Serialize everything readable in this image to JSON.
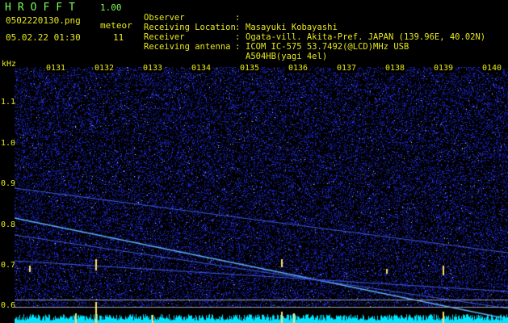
{
  "header": {
    "app_name": "HROFFT",
    "version": "1.00",
    "filename": "0502220130.png",
    "datetime": "05.02.22 01:30",
    "meteor_label": "meteor",
    "meteor_count": "11"
  },
  "info": [
    {
      "key": "Observer",
      "value": "Masayuki Kobayashi"
    },
    {
      "key": "Receiving Location",
      "value": "Ogata-vill. Akita-Pref. JAPAN (139.96E, 40.02N)"
    },
    {
      "key": "Receiver",
      "value": "ICOM IC-575 53.7492(@LCD)MHz USB"
    },
    {
      "key": "Receiving antenna",
      "value": "A504HB(yagi 4el)"
    }
  ],
  "axis": {
    "unit": "kHz",
    "freq_ticks": [
      "1.1",
      "1.0",
      "0.9",
      "0.8",
      "0.7",
      "0.6"
    ],
    "time_ticks": [
      "0131",
      "0132",
      "0133",
      "0134",
      "0135",
      "0136",
      "0137",
      "0138",
      "0139",
      "0140"
    ]
  },
  "colors": {
    "label": "#e8e81e",
    "title": "#7CFC55",
    "noise": "#1a22c8",
    "signal": "#5fb0ff",
    "meteor": "#ffe070",
    "baseline": "#00e5ff"
  }
}
